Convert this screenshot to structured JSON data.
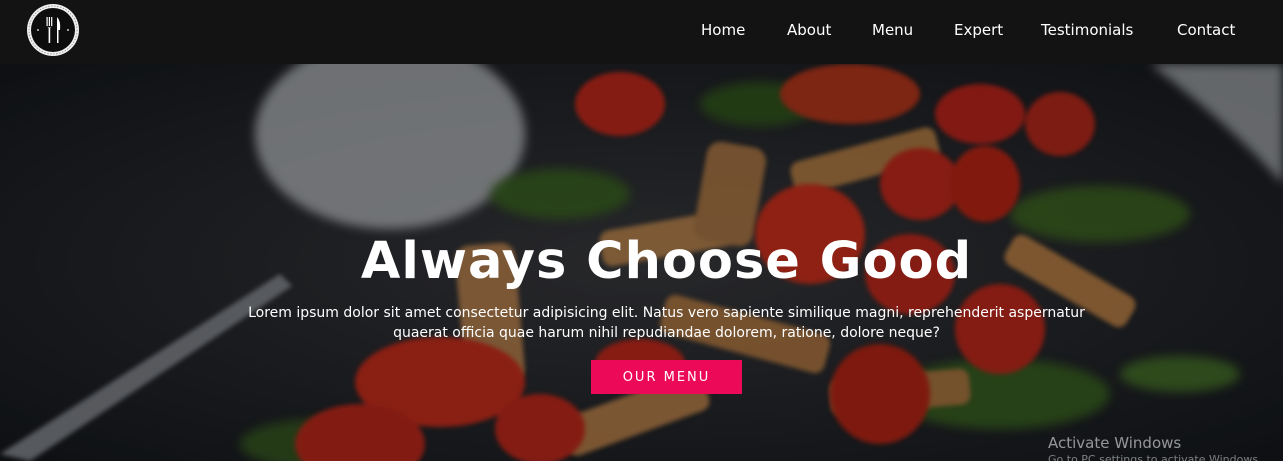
{
  "nav": {
    "items": [
      {
        "label": "Home"
      },
      {
        "label": "About"
      },
      {
        "label": "Menu"
      },
      {
        "label": "Expert"
      },
      {
        "label": "Testimonials"
      },
      {
        "label": "Contact"
      }
    ]
  },
  "hero": {
    "title": "Always Choose Good",
    "text": "Lorem ipsum dolor sit amet consectetur adipisicing elit. Natus vero sapiente similique magni, reprehenderit aspernatur quaerat officia quae harum nihil repudiandae dolorem, ratione, dolore neque?",
    "cta_label": "OUR MENU",
    "background_icon": "pasta-salad-photo"
  },
  "watermark": {
    "title": "Activate Windows",
    "subtitle": "Go to PC settings to activate Windows."
  },
  "colors": {
    "navbar": "#131313",
    "accent": "#ec0a58",
    "text": "#ffffff"
  },
  "logo": {
    "icon": "fork-knife-icon"
  }
}
